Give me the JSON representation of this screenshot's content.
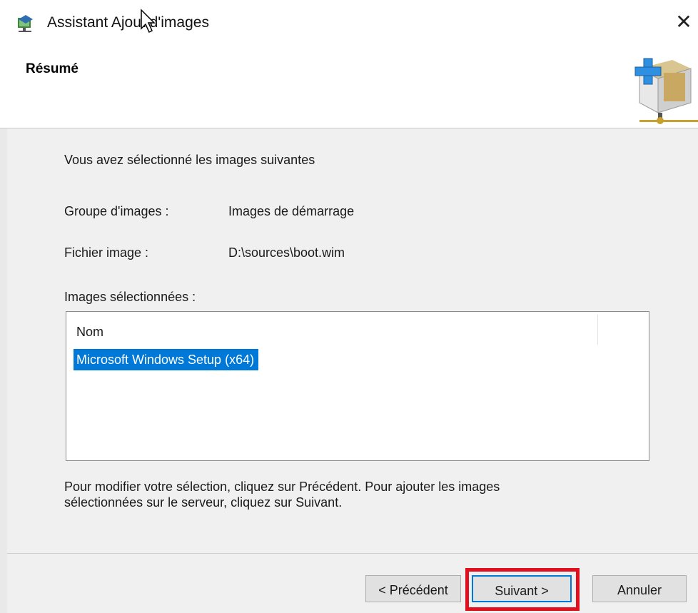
{
  "window": {
    "title": "Assistant Ajout d'images",
    "close_glyph": "✕",
    "app_icon": "wds-network-icon"
  },
  "header": {
    "title": "Résumé",
    "icon": "add-image-box-icon"
  },
  "summary": {
    "intro": "Vous avez sélectionné les images suivantes",
    "group_label": "Groupe d'images :",
    "group_value": "Images de démarrage",
    "file_label": "Fichier image :",
    "file_value": "D:\\sources\\boot.wim",
    "selected_label": "Images sélectionnées :",
    "list": {
      "column_header": "Nom",
      "items": [
        "Microsoft Windows Setup (x64)"
      ]
    },
    "hint_line1": "Pour modifier votre sélection, cliquez sur Précédent. Pour ajouter les images",
    "hint_line2": "sélectionnées sur le serveur, cliquez sur Suivant."
  },
  "buttons": {
    "previous": "< Précédent",
    "next": "Suivant >",
    "cancel": "Annuler"
  },
  "colors": {
    "selection": "#0078d7",
    "highlight": "#e0101e"
  }
}
